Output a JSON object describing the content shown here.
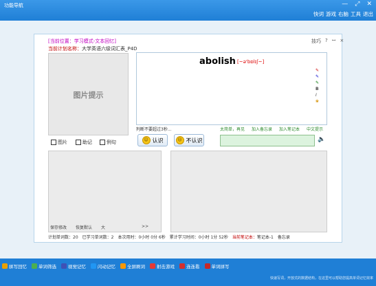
{
  "window": {
    "title": "功能导航"
  },
  "top_nav": [
    "快词",
    "游戏",
    "右脑",
    "工具",
    "退出"
  ],
  "window_controls": [
    "minimize-icon",
    "maximize-icon",
    "close-icon"
  ],
  "breadcrumb": "[当前位置：学习模式-文本回忆]",
  "plan": {
    "label": "当前计划名称：",
    "value": "大学英语六级词汇表_P4D"
  },
  "panel_controls": {
    "help": "技巧",
    "question": "?",
    "pin": "ꟷ",
    "close": "×"
  },
  "picture_hint": "图片提示",
  "word": {
    "text": "abolish",
    "phonetic": "[~ə'bɒlɪʃ~]"
  },
  "hint_text": "判断不要超过3秒...",
  "tools": [
    "✎",
    "✎",
    "✎",
    "B",
    "I",
    "❀"
  ],
  "checkboxes": [
    "图片",
    "助记",
    "例句"
  ],
  "buttons": {
    "know": "认识",
    "dont_know": "不认识"
  },
  "links": [
    "太简单，再见",
    "加入备忘录",
    "加入笔记本",
    "中文提示"
  ],
  "left_footer": [
    "保存修改",
    "恢复默认",
    "大",
    ">>"
  ],
  "status": {
    "plan_count": "计划单词数：20",
    "learned": "已学习单词数：2",
    "this_time": "本次用时：0小时 0分 6秒",
    "total_time": "累计学习时间：0小时 1分 52秒",
    "notebook_label": "当前笔记本：",
    "notebook_value": "笔记本-1",
    "memo": "备忘录"
  },
  "bottom_nav": [
    {
      "label": "拼写回忆",
      "icon": "pencil-icon",
      "color": "#e8a000"
    },
    {
      "label": "单词筛选",
      "icon": "magnifier-icon",
      "color": "#4caf50"
    },
    {
      "label": "视觉记忆",
      "icon": "eye-icon",
      "color": "#3f51b5"
    },
    {
      "label": "闪动记忆",
      "icon": "flash-icon",
      "color": "#2196f3"
    },
    {
      "label": "全屏刷词",
      "icon": "fullscreen-icon",
      "color": "#ff9800"
    },
    {
      "label": "射击游戏",
      "icon": "target-icon",
      "color": "#e53935"
    },
    {
      "label": "连连看",
      "icon": "link-icon",
      "color": "#d32f2f"
    },
    {
      "label": "单词拼写",
      "icon": "abc-icon",
      "color": "#c62828"
    }
  ],
  "footer": "快速写词，开放式的数据结构，在这里可以帮助您提高单词记忆效率"
}
